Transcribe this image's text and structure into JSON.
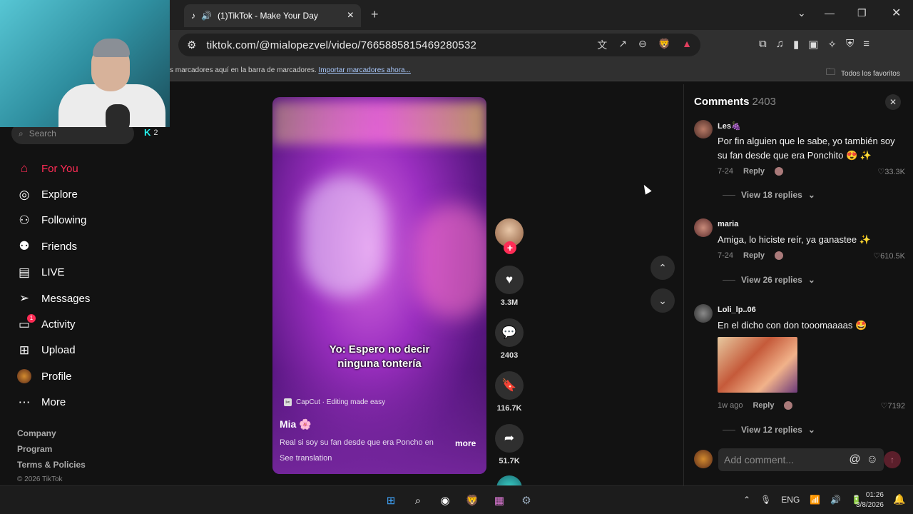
{
  "browser": {
    "tab_title": "(1)TikTok - Make Your Day",
    "url": "tiktok.com/@mialopezvel/video/7665885815469280532",
    "bookmarks_text": "s marcadores aquí en la barra de marcadores.",
    "bookmarks_link": "Importar marcadores ahora...",
    "all_favorites": "Todos los favoritos"
  },
  "sidebar": {
    "search_placeholder": "Search",
    "k_count": "2",
    "items": [
      {
        "label": "For You",
        "icon": "home-icon"
      },
      {
        "label": "Explore",
        "icon": "compass-icon"
      },
      {
        "label": "Following",
        "icon": "following-icon"
      },
      {
        "label": "Friends",
        "icon": "friends-icon"
      },
      {
        "label": "LIVE",
        "icon": "live-icon"
      },
      {
        "label": "Messages",
        "icon": "messages-icon"
      },
      {
        "label": "Activity",
        "icon": "activity-icon",
        "badge": "1"
      },
      {
        "label": "Upload",
        "icon": "upload-icon"
      },
      {
        "label": "Profile",
        "icon": "profile-avatar"
      },
      {
        "label": "More",
        "icon": "more-icon"
      }
    ],
    "footer": [
      "Company",
      "Program",
      "Terms & Policies"
    ],
    "copyright": "© 2026 TikTok"
  },
  "video": {
    "caption_line1": "Yo: Espero no decir",
    "caption_line2": "ninguna tontería",
    "capcut": "CapCut · Editing made easy",
    "author": "Mia 🌸",
    "description": "Real si soy su fan desde que era Poncho en",
    "more": "more",
    "see_translation": "See translation"
  },
  "actions": {
    "likes": "3.3M",
    "comments": "2403",
    "saves": "116.7K",
    "shares": "51.7K"
  },
  "comments": {
    "title": "Comments",
    "count": "2403",
    "items": [
      {
        "user": "Les🍇",
        "text": "Por fin alguien que le sabe, yo también soy su fan desde que era Ponchito 😍 ✨",
        "date": "7-24",
        "reply": "Reply",
        "likes": "33.3K",
        "view_replies": "View 18 replies"
      },
      {
        "user": "maria",
        "text": "Amiga, lo hiciste reír, ya ganastee ✨",
        "date": "7-24",
        "reply": "Reply",
        "likes": "610.5K",
        "view_replies": "View 26 replies"
      },
      {
        "user": "Loli_lp..06",
        "text": "En el dicho con don tooomaaaas 🤩",
        "date": "1w ago",
        "reply": "Reply",
        "likes": "7192",
        "view_replies": "View 12 replies"
      }
    ],
    "add_placeholder": "Add comment..."
  },
  "taskbar": {
    "lang": "ENG",
    "time": "01:26",
    "date": "3/8/2026"
  }
}
